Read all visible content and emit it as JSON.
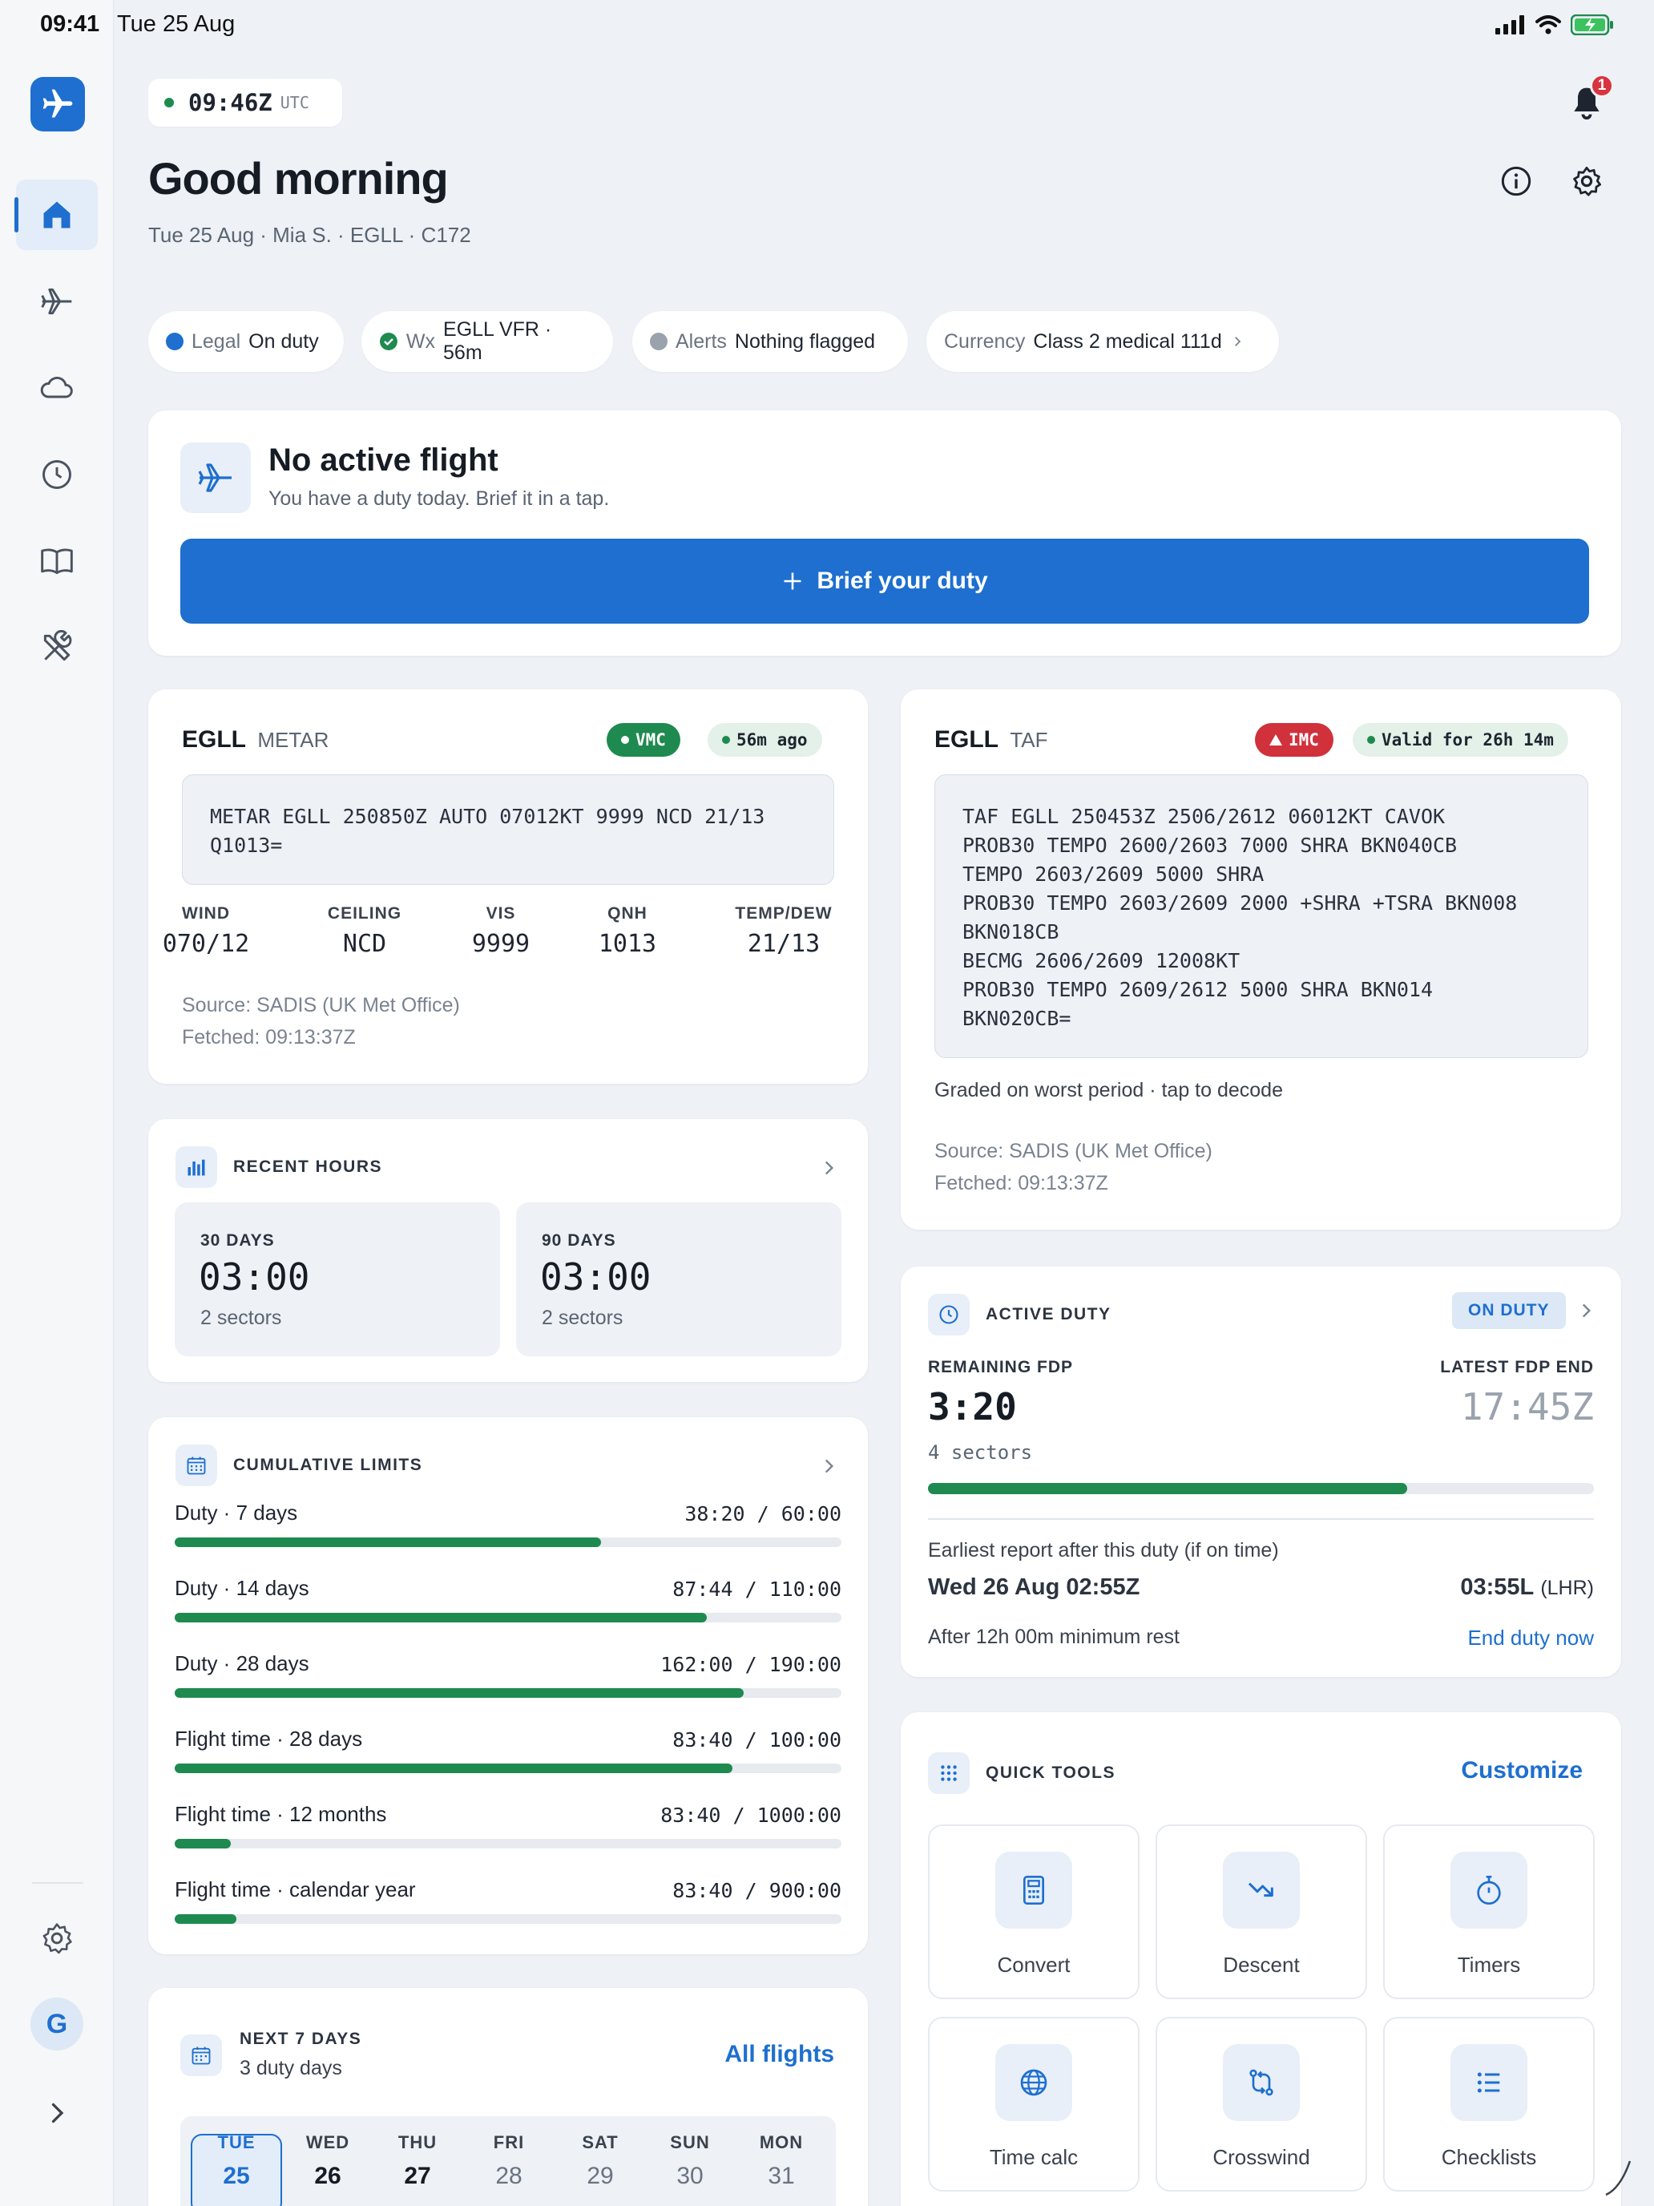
{
  "status_bar": {
    "time": "09:41",
    "date": "Tue 25 Aug"
  },
  "sidebar": {
    "items": [
      {
        "name": "home",
        "icon": "home-icon"
      },
      {
        "name": "flights",
        "icon": "plane-icon"
      },
      {
        "name": "weather",
        "icon": "cloud-icon"
      },
      {
        "name": "duty",
        "icon": "clock-icon"
      },
      {
        "name": "logbook",
        "icon": "book-icon"
      },
      {
        "name": "tools",
        "icon": "tools-icon"
      }
    ],
    "avatar_initial": "G"
  },
  "header": {
    "utc_time": "09:46Z",
    "utc_label": "UTC",
    "notification_count": "1",
    "greeting": "Good morning",
    "subline": "Tue 25 Aug · Mia S. · EGLL · C172"
  },
  "chips": [
    {
      "label": "Legal",
      "value": "On duty",
      "color": "#1E6FCF"
    },
    {
      "label": "Wx",
      "value": "EGLL VFR · 56m",
      "color": "#1E8A4F"
    },
    {
      "label": "Alerts",
      "value": "Nothing flagged",
      "color": "#9AA2AD"
    },
    {
      "label": "Currency",
      "value": "Class 2 medical 111d"
    }
  ],
  "active_flight": {
    "title": "No active flight",
    "subtitle": "You have a duty today. Brief it in a tap.",
    "button": "Brief your duty"
  },
  "metar": {
    "station": "EGLL",
    "kind": "METAR",
    "badge_vmc": "VMC",
    "age": "56m ago",
    "raw": "METAR EGLL 250850Z AUTO 07012KT 9999 NCD 21/13\nQ1013=",
    "stats": [
      {
        "label": "WIND",
        "value": "070/12"
      },
      {
        "label": "CEILING",
        "value": "NCD"
      },
      {
        "label": "VIS",
        "value": "9999"
      },
      {
        "label": "QNH",
        "value": "1013"
      },
      {
        "label": "TEMP/DEW",
        "value": "21/13"
      }
    ],
    "source": "Source: SADIS (UK Met Office)",
    "fetched": "Fetched: 09:13:37Z"
  },
  "taf": {
    "station": "EGLL",
    "kind": "TAF",
    "badge_imc": "IMC",
    "validity": "Valid for 26h 14m",
    "raw": "TAF EGLL 250453Z 2506/2612 06012KT CAVOK\nPROB30 TEMPO 2600/2603 7000 SHRA BKN040CB\nTEMPO 2603/2609 5000 SHRA\nPROB30 TEMPO 2603/2609 2000 +SHRA +TSRA BKN008\nBKN018CB\nBECMG 2606/2609 12008KT\nPROB30 TEMPO 2609/2612 5000 SHRA BKN014\nBKN020CB=",
    "graded": "Graded on worst period · tap to decode",
    "source": "Source: SADIS (UK Met Office)",
    "fetched": "Fetched: 09:13:37Z"
  },
  "recent_hours": {
    "title": "RECENT HOURS",
    "boxes": [
      {
        "label": "30 DAYS",
        "value": "03:00",
        "sub": "2 sectors"
      },
      {
        "label": "90 DAYS",
        "value": "03:00",
        "sub": "2 sectors"
      }
    ]
  },
  "cumulative_limits": {
    "title": "CUMULATIVE LIMITS",
    "rows": [
      {
        "label": "Duty · 7 days",
        "value": "38:20 / 60:00",
        "fraction": 0.639
      },
      {
        "label": "Duty · 14 days",
        "value": "87:44 / 110:00",
        "fraction": 0.798
      },
      {
        "label": "Duty · 28 days",
        "value": "162:00 / 190:00",
        "fraction": 0.853
      },
      {
        "label": "Flight time · 28 days",
        "value": "83:40 / 100:00",
        "fraction": 0.837
      },
      {
        "label": "Flight time · 12 months",
        "value": "83:40 / 1000:00",
        "fraction": 0.084
      },
      {
        "label": "Flight time · calendar year",
        "value": "83:40 / 900:00",
        "fraction": 0.093
      }
    ]
  },
  "active_duty": {
    "title": "ACTIVE DUTY",
    "status": "ON DUTY",
    "remaining_label": "REMAINING FDP",
    "remaining_value": "3:20",
    "sectors": "4 sectors",
    "latest_label": "LATEST FDP END",
    "latest_value": "17:45Z",
    "progress": 0.72,
    "earliest_label": "Earliest report after this duty (if on time)",
    "earliest_utc": "Wed 26 Aug 02:55Z",
    "earliest_local": "03:55L",
    "earliest_local_code": "(LHR)",
    "rest_note": "After 12h 00m minimum rest",
    "end_link": "End duty now"
  },
  "quick_tools": {
    "title": "QUICK TOOLS",
    "customize": "Customize",
    "tools": [
      {
        "label": "Convert",
        "icon": "calculator-icon"
      },
      {
        "label": "Descent",
        "icon": "descent-icon"
      },
      {
        "label": "Timers",
        "icon": "stopwatch-icon"
      },
      {
        "label": "Time calc",
        "icon": "globe-icon"
      },
      {
        "label": "Crosswind",
        "icon": "crosswind-icon"
      },
      {
        "label": "Checklists",
        "icon": "list-icon"
      }
    ]
  },
  "next_days": {
    "title": "NEXT 7 DAYS",
    "subtitle": "3 duty days",
    "link": "All flights",
    "days": [
      {
        "name": "TUE",
        "date": "25",
        "selected": true,
        "duty": true
      },
      {
        "name": "WED",
        "date": "26",
        "duty": true
      },
      {
        "name": "THU",
        "date": "27",
        "duty": true
      },
      {
        "name": "FRI",
        "date": "28"
      },
      {
        "name": "SAT",
        "date": "29"
      },
      {
        "name": "SUN",
        "date": "30"
      },
      {
        "name": "MON",
        "date": "31"
      }
    ]
  },
  "colors": {
    "accent": "#1E6FCF",
    "green": "#1E8A4F",
    "red": "#D8343F"
  }
}
